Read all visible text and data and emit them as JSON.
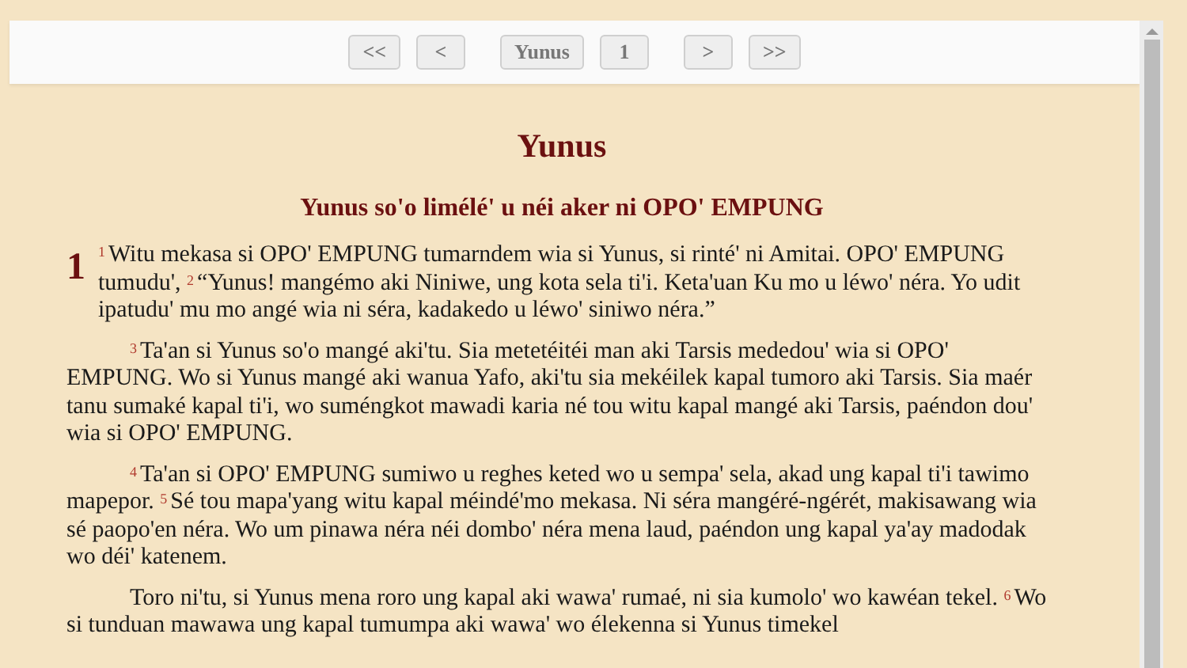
{
  "nav": {
    "groups": [
      [
        "<<",
        "<"
      ],
      [
        "Yunus",
        "1"
      ],
      [
        ">",
        ">>"
      ]
    ]
  },
  "title": "Yunus",
  "heading": "Yunus so'o limélé' u néi aker ni OPO' EMPUNG",
  "chapter": "1",
  "paragraphs": [
    "$^{1}$Witu mekasa si OPO' EMPUNG tumarndem wia si Yunus, si rinté' ni Amitai. OPO' EMPUNG tumudu', $^{2}$“Yunus! mangémo aki Niniwe, ung kota sela ti'i. Keta'uan Ku mo u léwo' néra. Yo udit ipatudu' mu mo angé wia ni séra, kadakedo u léwo' siniwo néra.”",
    "$^{3}$Ta'an si Yunus so'o mangé aki'tu. Sia metetéitéi man aki Tarsis mededou' wia si OPO' EMPUNG. Wo si Yunus mangé aki wanua Yafo, aki'tu sia mekéilek kapal tumoro aki Tarsis. Sia maér tanu sumaké kapal ti'i, wo suméngkot mawadi karia né tou witu kapal mangé aki Tarsis, paéndon dou' wia si OPO' EMPUNG.",
    "$^{4}$Ta'an si OPO' EMPUNG sumiwo u reghes keted wo u sempa' sela, akad ung kapal ti'i tawimo mapepor. $^{5}$Sé tou mapa'yang witu kapal méindé'mo mekasa. Ni séra mangéré-ngérét, makisawang wia sé paopo'en néra. Wo um pinawa néra néi dombo' néra mena laud, paéndon ung kapal ya'ay madodak wo déi' katenem.",
    "Toro ni'tu, si Yunus mena roro ung kapal aki wawa' rumaé, ni sia kumolo' wo kawéan tekel. $^{6}$Wo si tunduan mawawa ung kapal tumumpa aki wawa' wo élekenna si Yunus timekel"
  ]
}
